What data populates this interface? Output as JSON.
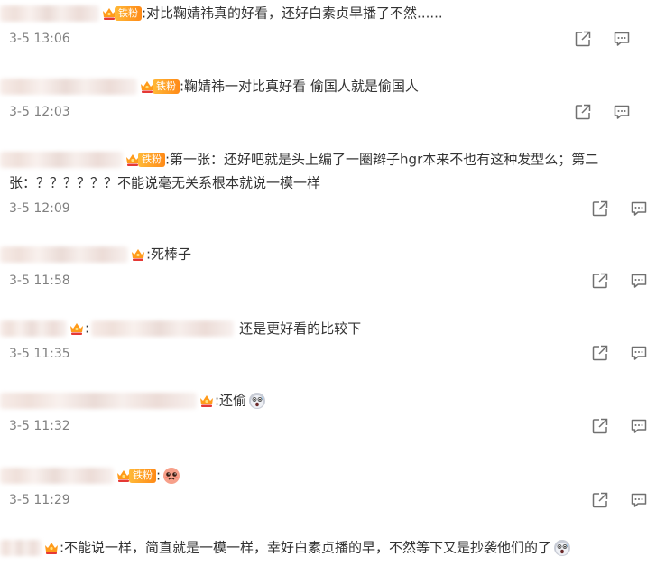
{
  "badge_label": "铁粉",
  "comments": [
    {
      "id": "c1",
      "text": ":对比鞠婧祎真的好看，还好白素贞早播了不然......",
      "time": "3-5 13:06",
      "badge": "fan"
    },
    {
      "id": "c2",
      "text": ":鞠婧祎一对比真好看 偷国人就是偷国人",
      "time": "3-5 12:03",
      "badge": "fan"
    },
    {
      "id": "c3",
      "text_line1": ":第一张：还好吧就是头上编了一圈辫子hgr本来不也有这种发型么；第二",
      "text_line2": "张：？？？？？？不能说毫无关系根本就说一模一样",
      "time": "3-5 12:09",
      "badge": "fan"
    },
    {
      "id": "c4",
      "text": ":死棒子",
      "time": "3-5 11:58",
      "badge": "crown"
    },
    {
      "id": "c5",
      "text_prefix": ":",
      "text": "还是更好看的比较下",
      "time": "3-5 11:35",
      "badge": "crown"
    },
    {
      "id": "c6",
      "text": ":还偷",
      "time": "3-5 11:32",
      "badge": "crown",
      "emoji": "shocked-face-icon"
    },
    {
      "id": "c7",
      "text": ":",
      "time": "3-5 11:29",
      "badge": "fan",
      "emoji": "angry-face-icon"
    },
    {
      "id": "c8",
      "text": ":不能说一样，简直就是一模一样，幸好白素贞播的早，不然等下又是抄袭他们的了",
      "badge": "crown",
      "emoji": "shocked-face-icon"
    }
  ],
  "colors": {
    "text": "#333333",
    "time": "#808080",
    "icon": "#707070",
    "badge_orange": "#ff8a17"
  },
  "icons": {
    "share": "share-icon",
    "comment": "comment-icon"
  }
}
